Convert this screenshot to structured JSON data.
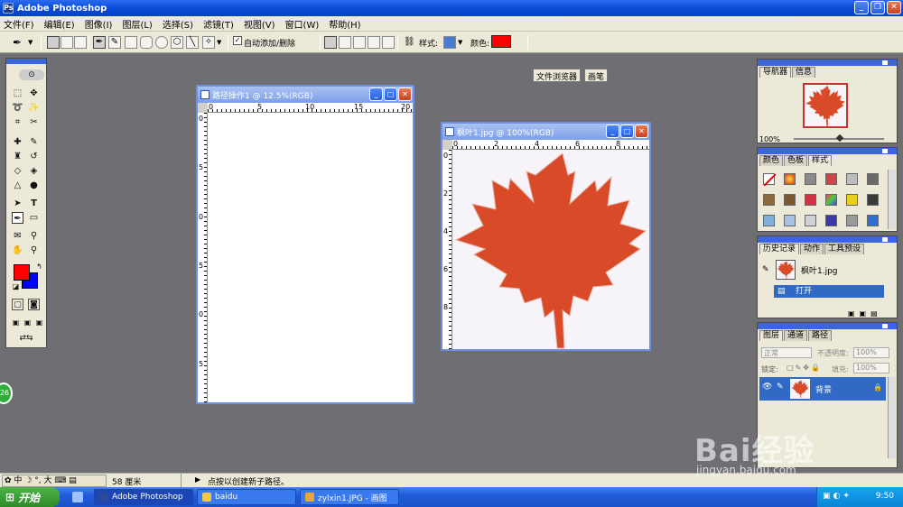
{
  "app": {
    "title": "Adobe Photoshop"
  },
  "menu": [
    "文件(F)",
    "编辑(E)",
    "图像(I)",
    "图层(L)",
    "选择(S)",
    "滤镜(T)",
    "视图(V)",
    "窗口(W)",
    "帮助(H)"
  ],
  "options_bar": {
    "auto_add_delete": "自动添加/删除",
    "style_label": "样式:",
    "color_label": "颜色:",
    "color_value": "#ff0000",
    "palette_tabs": [
      "文件浏览器",
      "画笔"
    ]
  },
  "doc1": {
    "title": "路径操作1 @ 12.5%(RGB)",
    "ruler_h": [
      "0",
      "5",
      "10",
      "15",
      "20"
    ],
    "ruler_v": [
      "0",
      "5",
      "0",
      "5",
      "0",
      "5"
    ]
  },
  "doc2": {
    "title": "枫叶1.jpg @ 100%(RGB)",
    "ruler_h": [
      "0",
      "2",
      "4",
      "6",
      "8"
    ],
    "ruler_v": [
      "0",
      "2",
      "4",
      "6",
      "8"
    ],
    "leaf_color": "#d94b28"
  },
  "navigator": {
    "tabs": [
      "导航器",
      "信息"
    ],
    "zoom": "100%"
  },
  "color_palette": {
    "tabs": [
      "颜色",
      "色板",
      "样式"
    ]
  },
  "history": {
    "tabs": [
      "历史记录",
      "动作",
      "工具预设"
    ],
    "snapshot": "枫叶1.jpg",
    "step": "打开"
  },
  "layers": {
    "tabs": [
      "图层",
      "通道",
      "路径"
    ],
    "blend_mode": "正常",
    "opacity_label": "不透明度:",
    "opacity_value": "100%",
    "lock_label": "锁定:",
    "fill_label": "填充:",
    "fill_value": "100%",
    "layer_name": "背景"
  },
  "status": {
    "ime": "中",
    "ime_mode": "大",
    "size": "58 厘米",
    "hint": "点按以创建新子路径。"
  },
  "taskbar": {
    "start": "开始",
    "items": [
      "Adobe Photoshop",
      "baidu",
      "zylxin1.JPG - 画图"
    ],
    "clock": "9:50"
  },
  "watermark": {
    "text": "Bai经验",
    "url": "jingyan.baidu.com"
  },
  "badge": "26"
}
